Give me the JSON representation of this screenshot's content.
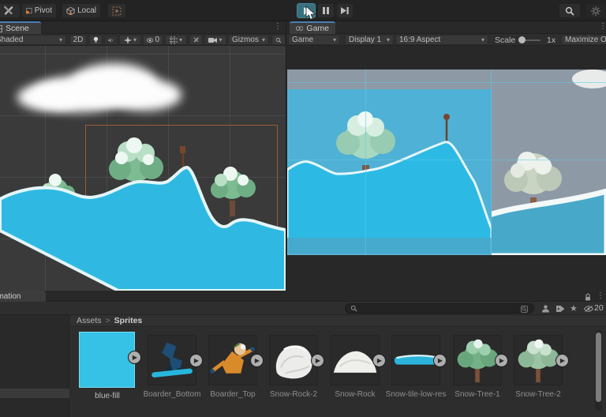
{
  "toolbar": {
    "pivot": "Pivot",
    "local": "Local"
  },
  "scene": {
    "tab": "Scene",
    "shading": "Shaded",
    "mode_2d": "2D",
    "hidden_count": "0",
    "gizmos": "Gizmos"
  },
  "game": {
    "tab": "Game",
    "display_mode": "Game",
    "display": "Display 1",
    "aspect": "16:9 Aspect",
    "scale_label": "Scale",
    "scale_value": "1x",
    "maximize": "Maximize On"
  },
  "project": {
    "animation_tab": "Animation",
    "breadcrumb_root": "Assets",
    "breadcrumb_sep": ">",
    "breadcrumb_current": "Sprites",
    "hidden_count": "20",
    "assets": [
      {
        "name": "blue-fill"
      },
      {
        "name": "Boarder_Bottom"
      },
      {
        "name": "Boarder_Top"
      },
      {
        "name": "Snow-Rock-2"
      },
      {
        "name": "Snow-Rock"
      },
      {
        "name": "Snow-tile-low-res"
      },
      {
        "name": "Snow-Tree-1"
      },
      {
        "name": "Snow-Tree-2"
      }
    ]
  },
  "colors": {
    "terrain_cyan": "#2fb9e2",
    "game_sky": "#4fb1d5",
    "game_gray_blue": "#8e99a6",
    "camera_gizmo": "#9a5c35",
    "selection_cyan": "#7adcf2",
    "play_active": "#38707f"
  }
}
